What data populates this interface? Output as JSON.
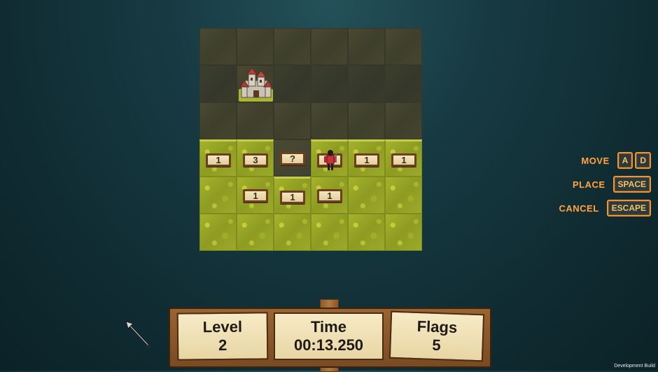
{
  "board": {
    "rows": [
      [
        "",
        "",
        "",
        "",
        "",
        ""
      ],
      [
        "",
        "castle",
        "",
        "",
        "",
        ""
      ],
      [
        "",
        "",
        "",
        "",
        "",
        ""
      ],
      [
        "1",
        "3",
        "?",
        "hero",
        "1",
        "1"
      ],
      [
        "",
        "1",
        "1",
        "1",
        "",
        ""
      ],
      [
        "",
        "",
        "",
        "",
        "",
        ""
      ]
    ]
  },
  "numbers": {
    "r3c0": "1",
    "r3c1": "3",
    "r3c2": "?",
    "r3c4": "1",
    "r3c5": "1",
    "r4c1": "1",
    "r4c2": "1",
    "r4c3": "1"
  },
  "controls": {
    "move_label": "MOVE",
    "move_key_a": "A",
    "move_key_d": "D",
    "place_label": "PLACE",
    "place_key": "SPACE",
    "cancel_label": "CANCEL",
    "cancel_key": "ESCAPE"
  },
  "hud": {
    "level_label": "Level",
    "level_value": "2",
    "time_label": "Time",
    "time_value": "00:13.250",
    "flags_label": "Flags",
    "flags_value": "5"
  },
  "footer": {
    "dev_build": "Development Build"
  },
  "colors": {
    "accent": "#f5a64a",
    "grass": "#9ca92a",
    "unrevealed": "#42422f",
    "plank": "#f4e6bf"
  },
  "icons": {
    "castle": "castle-icon",
    "hero": "knight-icon",
    "cursor": "arrow-cursor-icon"
  }
}
